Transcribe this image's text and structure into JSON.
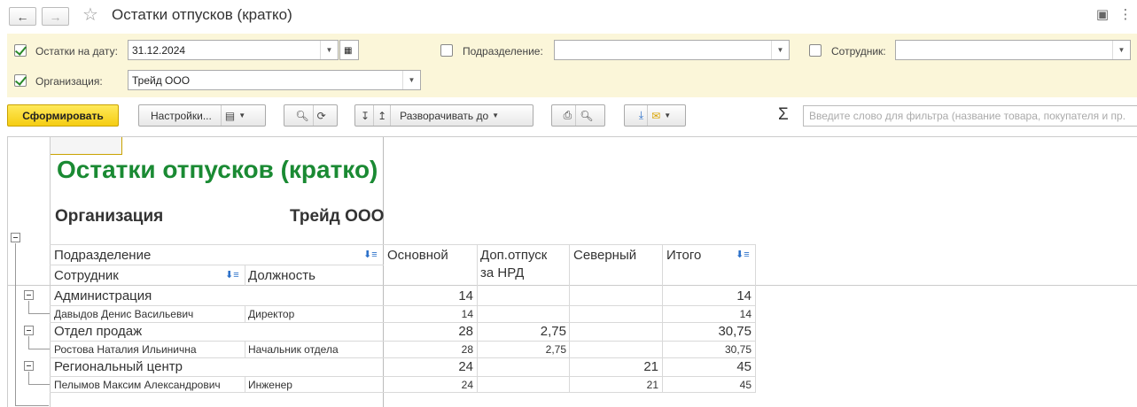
{
  "window": {
    "title": "Остатки отпусков (кратко)"
  },
  "filters": {
    "date_label": "Остатки на дату:",
    "date_value": "31.12.2024",
    "org_label": "Организация:",
    "org_value": "Трейд ООО",
    "dept_label": "Подразделение:",
    "dept_value": "",
    "emp_label": "Сотрудник:",
    "emp_value": ""
  },
  "toolbar": {
    "generate": "Сформировать",
    "settings": "Настройки...",
    "expand": "Разворачивать до",
    "search_placeholder": "Введите слово для фильтра (название товара, покупателя и пр."
  },
  "report": {
    "title": "Остатки отпусков (кратко)",
    "org_label": "Организация",
    "org_value": "Трейд ООО",
    "headers": {
      "dept": "Подразделение",
      "employee": "Сотрудник",
      "position": "Должность",
      "main": "Основной",
      "extra_line1": "Доп.отпуск",
      "extra_line2": "за НРД",
      "north": "Северный",
      "total": "Итого"
    },
    "groups": [
      {
        "name": "Администрация",
        "main": "14",
        "extra": "",
        "north": "",
        "total": "14",
        "row": {
          "employee": "Давыдов Денис Васильевич",
          "position": "Директор",
          "main": "14",
          "extra": "",
          "north": "",
          "total": "14"
        }
      },
      {
        "name": "Отдел продаж",
        "main": "28",
        "extra": "2,75",
        "north": "",
        "total": "30,75",
        "row": {
          "employee": "Ростова Наталия Ильинична",
          "position": "Начальник отдела",
          "main": "28",
          "extra": "2,75",
          "north": "",
          "total": "30,75"
        }
      },
      {
        "name": "Региональный центр",
        "main": "24",
        "extra": "",
        "north": "21",
        "total": "45",
        "row": {
          "employee": "Пелымов Максим Александрович",
          "position": "Инженер",
          "main": "24",
          "extra": "",
          "north": "21",
          "total": "45"
        }
      }
    ]
  }
}
